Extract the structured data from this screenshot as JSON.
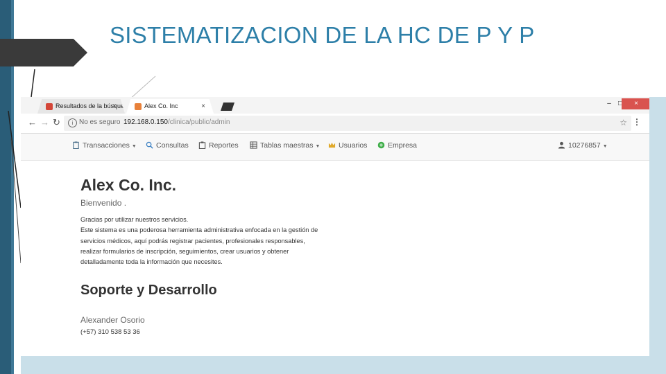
{
  "slide": {
    "title": "SISTEMATIZACION DE LA HC DE P Y P"
  },
  "browser": {
    "tabs": [
      {
        "label": "Resultados de la búsqued",
        "icon": "gmail-icon",
        "active": false
      },
      {
        "label": "Alex Co. Inc",
        "icon": "app-favicon",
        "active": true
      }
    ],
    "tab_close": "×",
    "window_controls": {
      "minimize": "–",
      "maximize": "□",
      "close": "×"
    },
    "security_label": "No es seguro",
    "url_host": "192.168.0.150",
    "url_path": "/clinica/public/admin"
  },
  "app_nav": {
    "items": [
      {
        "label": "Transacciones",
        "icon": "clipboard-icon",
        "dropdown": true
      },
      {
        "label": "Consultas",
        "icon": "search-icon",
        "dropdown": false
      },
      {
        "label": "Reportes",
        "icon": "report-icon",
        "dropdown": false
      },
      {
        "label": "Tablas maestras",
        "icon": "table-icon",
        "dropdown": true
      },
      {
        "label": "Usuarios",
        "icon": "crown-icon",
        "dropdown": false
      },
      {
        "label": "Empresa",
        "icon": "globe-icon",
        "dropdown": false
      }
    ],
    "user": {
      "label": "10276857",
      "icon": "user-icon"
    }
  },
  "content": {
    "company": "Alex Co. Inc.",
    "welcome": "Bienvenido .",
    "intro_lines": [
      "Gracias por utilizar nuestros servicios.",
      "Este sistema es una poderosa herramienta administrativa enfocada en la gestión de",
      "servicios médicos, aquí podrás registrar pacientes, profesionales responsables,",
      "realizar formularios de inscripción, seguimientos, crear usuarios y obtener",
      "detalladamente toda la información que necesites."
    ],
    "support_title": "Soporte y Desarrollo",
    "contact_name": "Alexander Osorio",
    "contact_phone": "(+57) 310 538 53 36"
  },
  "colors": {
    "title": "#2d7fa8",
    "sidebar_dark": "#2a5d78",
    "accent_bg": "#c9dfe9",
    "close_button": "#d9534f"
  }
}
